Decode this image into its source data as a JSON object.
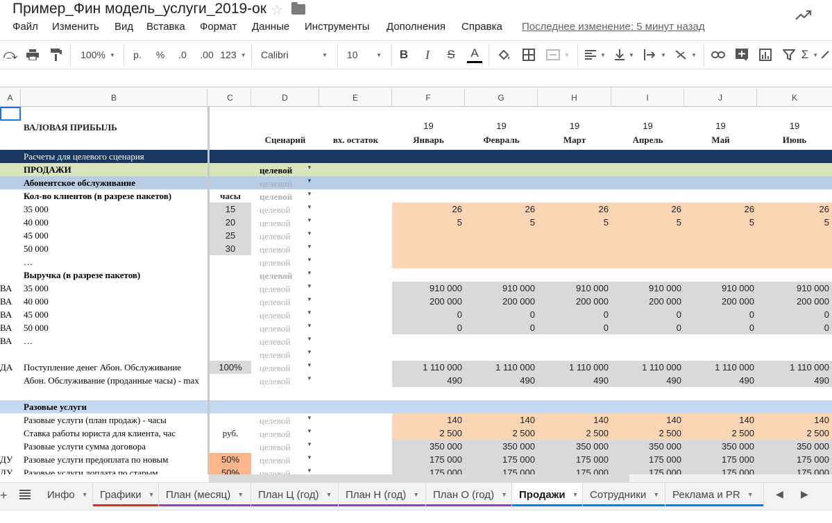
{
  "document": {
    "title": "Пример_Фин модель_услуги_2019-ок"
  },
  "menu": {
    "items": [
      "Файл",
      "Изменить",
      "Вид",
      "Вставка",
      "Формат",
      "Данные",
      "Инструменты",
      "Дополнения",
      "Справка"
    ],
    "last_edit": "Последнее изменение: 5 минут назад"
  },
  "toolbar": {
    "zoom": "100%",
    "currency": "р.",
    "percent": "%",
    "decimal_decrease": ".0",
    "decimal_increase": ".00",
    "number_format": "123",
    "font": "Calibri",
    "font_size": "10",
    "bold": "B",
    "italic": "I",
    "strike": "S",
    "text_color": "A"
  },
  "columns": [
    "A",
    "B",
    "C",
    "D",
    "E",
    "F",
    "G",
    "H",
    "I",
    "J",
    "K"
  ],
  "header": {
    "title": "ВАЛОВАЯ ПРИБЫЛЬ",
    "scenario": "Сценарий",
    "opening": "вх. остаток",
    "year": "19",
    "months": [
      "Январь",
      "Февраль",
      "Март",
      "Апрель",
      "Май",
      "Июнь"
    ]
  },
  "rows": [
    {
      "a": "",
      "b": "Расчеты для целевого сценария",
      "c": "",
      "d": "",
      "vals": [],
      "style": "section-dark"
    },
    {
      "a": "",
      "b": "ПРОДАЖИ",
      "c": "",
      "d": "целевой",
      "vals": [],
      "style": "section-green"
    },
    {
      "a": "",
      "b": "Абонентское обслуживание",
      "c": "",
      "d": "целевой",
      "vals": [],
      "style": "section-blue"
    },
    {
      "a": "",
      "b": "Кол-во клиентов (в разрезе пакетов)",
      "c": "часы",
      "d": "целевой",
      "vals": [],
      "style": "bold"
    },
    {
      "a": "",
      "b": "35 000",
      "c": "15",
      "d": "целевой",
      "vals": [
        "26",
        "26",
        "26",
        "26",
        "26",
        "26"
      ],
      "style": "peach"
    },
    {
      "a": "",
      "b": "40 000",
      "c": "20",
      "d": "целевой",
      "vals": [
        "5",
        "5",
        "5",
        "5",
        "5",
        "5"
      ],
      "style": "peach"
    },
    {
      "a": "",
      "b": "45 000",
      "c": "25",
      "d": "целевой",
      "vals": [
        "",
        "",
        "",
        "",
        "",
        ""
      ],
      "style": "peach"
    },
    {
      "a": "",
      "b": "50 000",
      "c": "30",
      "d": "целевой",
      "vals": [
        "",
        "",
        "",
        "",
        "",
        ""
      ],
      "style": "peach"
    },
    {
      "a": "",
      "b": "…",
      "c": "",
      "d": "целевой",
      "vals": [
        "",
        "",
        "",
        "",
        "",
        ""
      ],
      "style": "peach"
    },
    {
      "a": "",
      "b": "Выручка (в разрезе пакетов)",
      "c": "",
      "d": "целевой",
      "vals": [],
      "style": "bold"
    },
    {
      "a": "ВА",
      "b": "35 000",
      "c": "",
      "d": "целевой",
      "vals": [
        "910 000",
        "910 000",
        "910 000",
        "910 000",
        "910 000",
        "910 000"
      ],
      "style": "gray"
    },
    {
      "a": "ВА",
      "b": "40 000",
      "c": "",
      "d": "целевой",
      "vals": [
        "200 000",
        "200 000",
        "200 000",
        "200 000",
        "200 000",
        "200 000"
      ],
      "style": "gray"
    },
    {
      "a": "ВА",
      "b": "45 000",
      "c": "",
      "d": "целевой",
      "vals": [
        "0",
        "0",
        "0",
        "0",
        "0",
        "0"
      ],
      "style": "gray"
    },
    {
      "a": "ВА",
      "b": "50 000",
      "c": "",
      "d": "целевой",
      "vals": [
        "0",
        "0",
        "0",
        "0",
        "0",
        "0"
      ],
      "style": "gray"
    },
    {
      "a": "ВА",
      "b": "…",
      "c": "",
      "d": "целевой",
      "vals": [],
      "style": "plain"
    },
    {
      "a": "",
      "b": "",
      "c": "",
      "d": "целевой",
      "vals": [],
      "style": "plain"
    },
    {
      "a": "ДА",
      "b": "Поступление денег Абон. Обслуживание",
      "c": "100%",
      "d": "целевой",
      "vals": [
        "1 110 000",
        "1 110 000",
        "1 110 000",
        "1 110 000",
        "1 110 000",
        "1 110 000"
      ],
      "style": "gray"
    },
    {
      "a": "",
      "b": "Абон. Обслуживание (проданные часы) - max",
      "c": "",
      "d": "целевой",
      "vals": [
        "490",
        "490",
        "490",
        "490",
        "490",
        "490"
      ],
      "style": "gray"
    },
    {
      "a": "",
      "b": "",
      "c": "",
      "d": "",
      "vals": [],
      "style": "plain"
    },
    {
      "a": "",
      "b": "Разовые услуги",
      "c": "",
      "d": "",
      "vals": [],
      "style": "section-lightblue"
    },
    {
      "a": "",
      "b": "Разовые услуги (план продаж) - часы",
      "c": "",
      "d": "целевой",
      "vals": [
        "140",
        "140",
        "140",
        "140",
        "140",
        "140"
      ],
      "style": "peach"
    },
    {
      "a": "",
      "b": "Ставка работы юриста для клиента, час",
      "c": "руб.",
      "d": "целевой",
      "vals": [
        "2 500",
        "2 500",
        "2 500",
        "2 500",
        "2 500",
        "2 500"
      ],
      "style": "peach"
    },
    {
      "a": "",
      "b": "Разовые услуги сумма договора",
      "c": "",
      "d": "целевой",
      "vals": [
        "350 000",
        "350 000",
        "350 000",
        "350 000",
        "350 000",
        "350 000"
      ],
      "style": "gray"
    },
    {
      "a": "ДУ",
      "b": "Разовые услуги предоплата по новым",
      "c": "50%",
      "d": "целевой",
      "vals": [
        "175 000",
        "175 000",
        "175 000",
        "175 000",
        "175 000",
        "175 000"
      ],
      "style": "gray"
    },
    {
      "a": "ДУ",
      "b": "Разовые услуги доплата по старым",
      "c": "50%",
      "d": "целевой",
      "vals": [
        "175 000",
        "175 000",
        "175 000",
        "175 000",
        "175 000",
        "175 000"
      ],
      "style": "gray"
    }
  ],
  "sheets": [
    {
      "name": "Инфо",
      "color": ""
    },
    {
      "name": "Графики",
      "color": "#c0392b"
    },
    {
      "name": "План (месяц)",
      "color": "#8e44ad"
    },
    {
      "name": "План Ц (год)",
      "color": "#8e44ad"
    },
    {
      "name": "План Н (год)",
      "color": "#8e44ad"
    },
    {
      "name": "План О (год)",
      "color": "#8e44ad"
    },
    {
      "name": "Продажи",
      "color": "#1a73e8"
    },
    {
      "name": "Сотрудники",
      "color": "#1a73e8"
    },
    {
      "name": "Реклама и PR",
      "color": "#1a73e8"
    }
  ],
  "colors": {
    "section_dark": "#17375e",
    "section_green": "#d8e4bc",
    "section_blue": "#b8cce4",
    "peach": "#fcd5b4",
    "gray": "#d9d9d9",
    "c_input_gray": "#d9d9d9",
    "c_input_peach": "#fcb58a"
  }
}
